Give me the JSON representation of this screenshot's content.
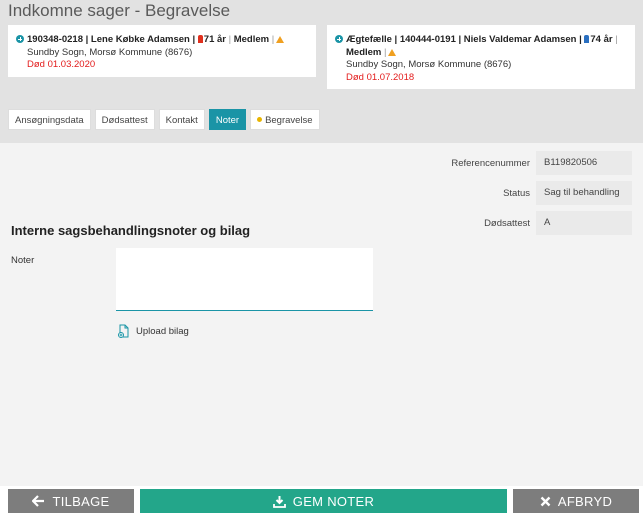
{
  "page": {
    "title": "Indkomne sager - Begravelse"
  },
  "cards": [
    {
      "id_name": "190348-0218 | Lene Købke Adamsen |",
      "age": "71 år",
      "member": "Medlem",
      "parish": "Sundby Sogn, Morsø Kommune (8676)",
      "death": "Død 01.03.2020"
    },
    {
      "relation": "Ægtefælle | 140444-0191 | Niels Valdemar Adamsen |",
      "age": "74 år",
      "member": "Medlem",
      "parish": "Sundby Sogn, Morsø Kommune (8676)",
      "death": "Død 01.07.2018"
    }
  ],
  "tabs": [
    "Ansøgningsdata",
    "Dødsattest",
    "Kontakt",
    "Noter",
    "Begravelse"
  ],
  "active_tab": "Noter",
  "info": [
    {
      "label": "Referencenummer",
      "value": "B119820506"
    },
    {
      "label": "Status",
      "value": "Sag til behandling"
    },
    {
      "label": "Dødsattest",
      "value": "A"
    }
  ],
  "notes": {
    "section_title": "Interne sagsbehandlingsnoter og bilag",
    "label": "Noter",
    "value": "",
    "upload_label": "Upload bilag"
  },
  "buttons": {
    "back": "TILBAGE",
    "save": "GEM NOTER",
    "cancel": "AFBRYD"
  },
  "colors": {
    "accent": "#1a94a6",
    "save": "#23a68a",
    "grey_button": "#7d7d7d",
    "death": "#e31b1b"
  },
  "icons": {
    "person": "plus-circle-icon",
    "warning": "warning-icon",
    "upload": "upload-file-icon",
    "back": "arrow-left-icon",
    "save": "download-icon",
    "cancel": "close-icon"
  }
}
